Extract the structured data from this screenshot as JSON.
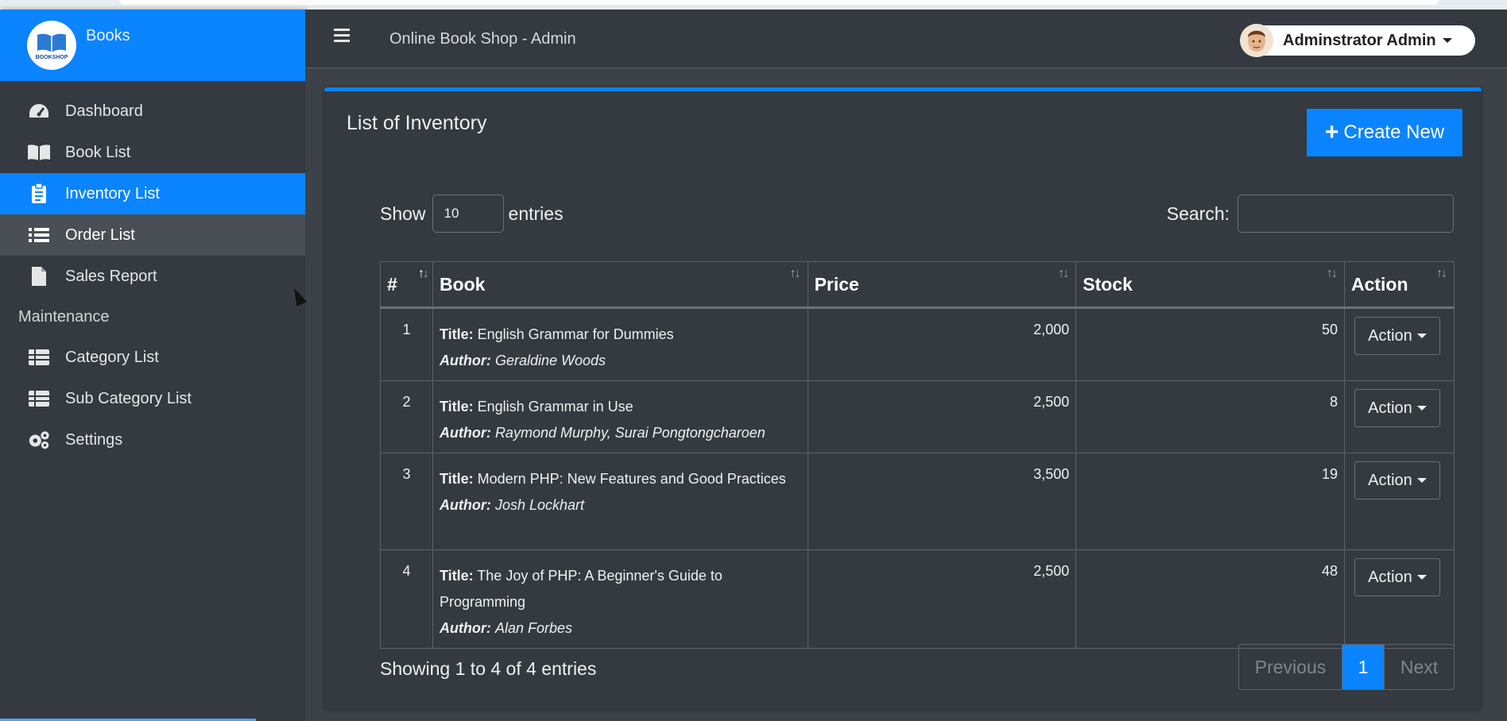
{
  "brand": {
    "name": "Books",
    "logo_text": "BOOKSHOP"
  },
  "header": {
    "title": "Online Book Shop - Admin",
    "user": "Adminstrator Admin"
  },
  "sidebar": {
    "items": [
      {
        "label": "Dashboard",
        "icon": "dashboard-icon"
      },
      {
        "label": "Book List",
        "icon": "book-icon"
      },
      {
        "label": "Inventory List",
        "icon": "clipboard-icon"
      },
      {
        "label": "Order List",
        "icon": "list-icon"
      },
      {
        "label": "Sales Report",
        "icon": "file-icon"
      }
    ],
    "section_header": "Maintenance",
    "maintenance": [
      {
        "label": "Category List",
        "icon": "table-icon"
      },
      {
        "label": "Sub Category List",
        "icon": "table-icon"
      },
      {
        "label": "Settings",
        "icon": "gears-icon"
      }
    ]
  },
  "card": {
    "title": "List of Inventory",
    "create_label": "Create New"
  },
  "controls": {
    "show": "Show",
    "entries_value": "10",
    "entries": "entries",
    "search_label": "Search:"
  },
  "table": {
    "columns": [
      "#",
      "Book",
      "Price",
      "Stock",
      "Action"
    ],
    "title_label": "Title:",
    "author_label": "Author:",
    "rows": [
      {
        "num": "1",
        "title": "English Grammar for Dummies",
        "author": "Geraldine Woods",
        "price": "2,000",
        "stock": "50",
        "action": "Action"
      },
      {
        "num": "2",
        "title": "English Grammar in Use",
        "author": "Raymond Murphy, Surai Pongtongcharoen",
        "price": "2,500",
        "stock": "8",
        "action": "Action"
      },
      {
        "num": "3",
        "title": "Modern PHP: New Features and Good Practices",
        "author": "Josh Lockhart",
        "price": "3,500",
        "stock": "19",
        "action": "Action"
      },
      {
        "num": "4",
        "title": "The Joy of PHP: A Beginner's Guide to Programming",
        "author": "Alan Forbes",
        "price": "2,500",
        "stock": "48",
        "action": "Action"
      }
    ]
  },
  "footer": {
    "info": "Showing 1 to 4 of 4 entries",
    "previous": "Previous",
    "page": "1",
    "next": "Next"
  },
  "colors": {
    "accent": "#0a84ff",
    "sidebar_bg": "#343a40",
    "content_bg": "#3d4248"
  }
}
